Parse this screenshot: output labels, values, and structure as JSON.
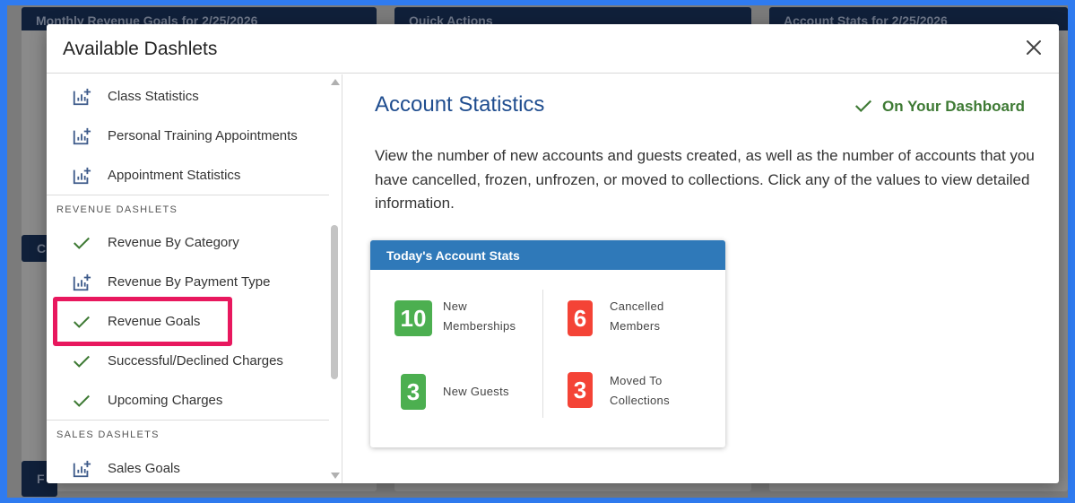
{
  "background": {
    "cards": [
      {
        "title": "Monthly Revenue Goals for 2/25/2026"
      },
      {
        "title": "Quick Actions"
      },
      {
        "title": "Account Stats for 2/25/2026"
      }
    ],
    "side_letter_1": "C",
    "side_letter_2": "F"
  },
  "modal": {
    "title": "Available Dashlets",
    "close_icon": "close-icon"
  },
  "list": {
    "top_items": [
      {
        "label": "Class Statistics",
        "icon": "add-chart-icon"
      },
      {
        "label": "Personal Training Appointments",
        "icon": "add-chart-icon"
      },
      {
        "label": "Appointment Statistics",
        "icon": "add-chart-icon"
      }
    ],
    "revenue_section": "REVENUE DASHLETS",
    "revenue_items": [
      {
        "label": "Revenue By Category",
        "icon": "check-icon"
      },
      {
        "label": "Revenue By Payment Type",
        "icon": "add-chart-icon"
      },
      {
        "label": "Revenue Goals",
        "icon": "check-icon"
      },
      {
        "label": "Successful/Declined Charges",
        "icon": "check-icon"
      },
      {
        "label": "Upcoming Charges",
        "icon": "check-icon"
      }
    ],
    "sales_section": "SALES DASHLETS",
    "sales_items": [
      {
        "label": "Sales Goals",
        "icon": "add-chart-icon"
      }
    ]
  },
  "detail": {
    "title": "Account Statistics",
    "status": "On Your Dashboard",
    "description": "View the number of new accounts and guests created, as well as the number of accounts that you have cancelled, frozen, unfrozen, or moved to collections. Click any of the values to view detailed information.",
    "preview": {
      "header": "Today's Account Stats",
      "stats": [
        {
          "value": "10",
          "label_1": "New",
          "label_2": "Memberships",
          "color": "#4caf50"
        },
        {
          "value": "6",
          "label_1": "Cancelled",
          "label_2": "Members",
          "color": "#f44336"
        },
        {
          "value": "3",
          "label_1": "New Guests",
          "label_2": "",
          "color": "#4caf50"
        },
        {
          "value": "3",
          "label_1": "Moved To",
          "label_2": "Collections",
          "color": "#f44336"
        }
      ]
    }
  },
  "colors": {
    "accent_blue": "#1f4d8f",
    "check_green": "#3e7a34",
    "highlight": "#e8185e",
    "card_header": "#2f79b9"
  }
}
